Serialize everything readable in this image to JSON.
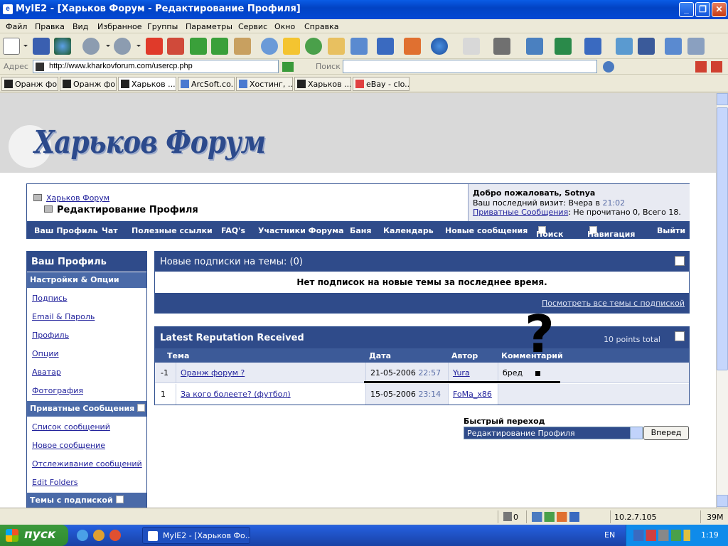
{
  "window": {
    "title": "MyIE2 - [Харьков Форум - Редактирование Профиля]"
  },
  "menu": [
    "Файл",
    "Правка",
    "Вид",
    "Избранное",
    "Группы",
    "Параметры",
    "Сервис",
    "Окно",
    "Справка"
  ],
  "address": {
    "label": "Адрес",
    "url": "http://www.kharkovforum.com/usercp.php",
    "search_label": "Поиск"
  },
  "tabs": [
    "Оранж фо...",
    "Оранж фо...",
    "Харьков ...",
    "ArcSoft.co...",
    "Хостинг, ...",
    "Харьков ...",
    "eBay - clo..."
  ],
  "site": {
    "logo": "Харьков Форум",
    "breadcrumb_home": "Харьков Форум",
    "breadcrumb_current": "Редактирование Профиля",
    "welcome": "Добро пожаловать, Sotnya",
    "last_visit_prefix": "Ваш последний визит: Вчера в",
    "last_visit_time": "21:02",
    "pm_link": "Приватные Сообщения",
    "pm_status": ": Не прочитано 0, Всего 18."
  },
  "nav": [
    "Ваш Профиль",
    "Чат",
    "Полезные ссылки",
    "FAQ's",
    "Участники Форума",
    "Баня",
    "Календарь",
    "Новые сообщения",
    "Поиск",
    "Навигация",
    "Выйти"
  ],
  "sidebar": {
    "title": "Ваш Профиль",
    "sec1": "Настройки & Опции",
    "links1": [
      "Подпись",
      "Email & Пароль",
      "Профиль",
      "Опции",
      "Аватар",
      "Фотография"
    ],
    "sec2": "Приватные Сообщения",
    "links2": [
      "Список сообщений",
      "Новое сообщение",
      "Отслеживание сообщений",
      "Edit Folders"
    ],
    "sec3": "Темы с подпиской"
  },
  "subscriptions": {
    "title": "Новые подписки на темы:",
    "count": "(0)",
    "empty": "Нет подписок на новые темы за последнее время.",
    "view_all": "Посмотреть все темы с подпиской"
  },
  "reputation": {
    "title": "Latest Reputation Received",
    "total": "10 points total",
    "columns": [
      "Тема",
      "Дата",
      "Автор",
      "Комментарий"
    ],
    "rows": [
      {
        "points": "-1",
        "topic": "Оранж форум ?",
        "date": "21-05-2006",
        "time": "22:57",
        "author": "Yura",
        "comment": "бред"
      },
      {
        "points": "1",
        "topic": "За кого болеете? (футбол)",
        "date": "15-05-2006",
        "time": "23:14",
        "author": "FoMa_x86",
        "comment": ""
      }
    ]
  },
  "annotation": {
    "mark": "?"
  },
  "quickjump": {
    "label": "Быстрый переход",
    "selected": "Редактирование Профиля",
    "button": "Вперед"
  },
  "status": {
    "trash_count": "0",
    "ip": "10.2.7.105",
    "memory": "39M"
  },
  "taskbar": {
    "start": "пуск",
    "app": "MyIE2 - [Харьков Фо...",
    "lang": "EN",
    "clock": "1:19"
  }
}
